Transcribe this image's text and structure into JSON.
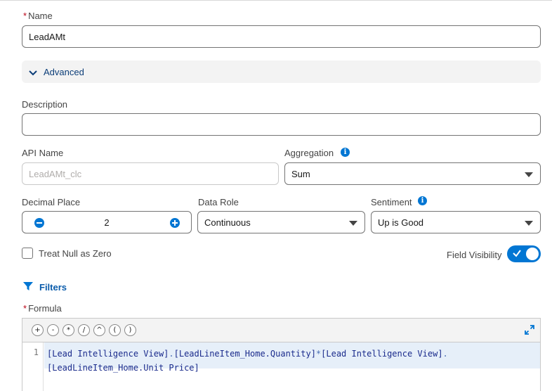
{
  "form": {
    "name": {
      "required_mark": "*",
      "label": "Name",
      "value": "LeadAMt"
    },
    "advanced": {
      "label": "Advanced",
      "icon": "chevron-down-icon"
    },
    "description": {
      "label": "Description",
      "value": ""
    },
    "api_name": {
      "label": "API Name",
      "placeholder": "LeadAMt_clc"
    },
    "aggregation": {
      "label": "Aggregation",
      "value": "Sum",
      "info_icon": "info-icon"
    },
    "decimal_place": {
      "label": "Decimal Place",
      "value": "2"
    },
    "data_role": {
      "label": "Data Role",
      "value": "Continuous"
    },
    "sentiment": {
      "label": "Sentiment",
      "value": "Up is Good",
      "info_icon": "info-icon"
    },
    "treat_null": {
      "label": "Treat Null as Zero",
      "checked": false
    },
    "field_visibility": {
      "label": "Field Visibility",
      "on": true
    },
    "filters": {
      "label": "Filters",
      "icon": "filter-icon"
    },
    "formula": {
      "required_mark": "*",
      "label": "Formula",
      "operators": [
        "+",
        "-",
        "*",
        "/",
        "^",
        "(",
        ")"
      ],
      "line_number": "1",
      "line1_parts": [
        "[Lead Intelligence View]",
        ".",
        "[LeadLineItem_Home.Quantity]",
        "*",
        "[Lead Intelligence View]",
        "."
      ],
      "line2": "[LeadLineItem_Home.Unit Price]"
    }
  },
  "colors": {
    "accent": "#0176d3",
    "link": "#0b5cab",
    "required": "#ba0517"
  }
}
